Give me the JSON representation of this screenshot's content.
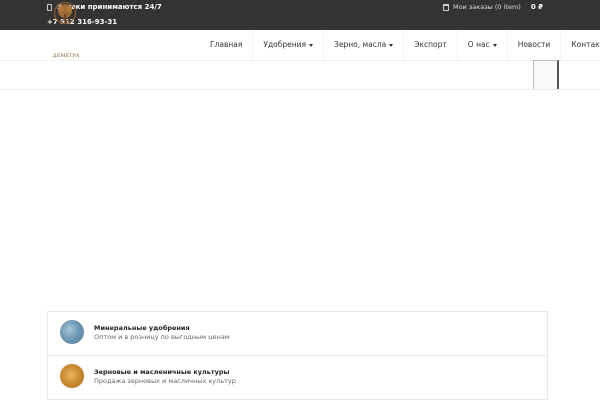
{
  "topbar": {
    "hours": "Заявки принимаются 24/7",
    "phone": "+7 912 316-93-31",
    "cart_label": "Мои заказы (0 item)",
    "cart_total": "0 ₽"
  },
  "logo": {
    "text": "ДЕМЕТРА"
  },
  "nav": {
    "items": [
      {
        "label": "Главная"
      },
      {
        "label": "Удобрения"
      },
      {
        "label": "Зерно, масла"
      },
      {
        "label": "Экспорт"
      },
      {
        "label": "О нас"
      },
      {
        "label": "Новости"
      },
      {
        "label": "Контакты"
      }
    ]
  },
  "categories": [
    {
      "title": "Минеральные удобрения",
      "subtitle": "Оптом и в розницу по выгодным ценам"
    },
    {
      "title": "Зерновые и масленичные культуры",
      "subtitle": "Продажа зерновых и масличных культур"
    }
  ],
  "icons": {
    "clock": "clock-icon",
    "cart": "cart-icon",
    "search": "search-icon"
  },
  "colors": {
    "topbar_bg": "#333333",
    "brand_brown": "#8b5a2b"
  }
}
